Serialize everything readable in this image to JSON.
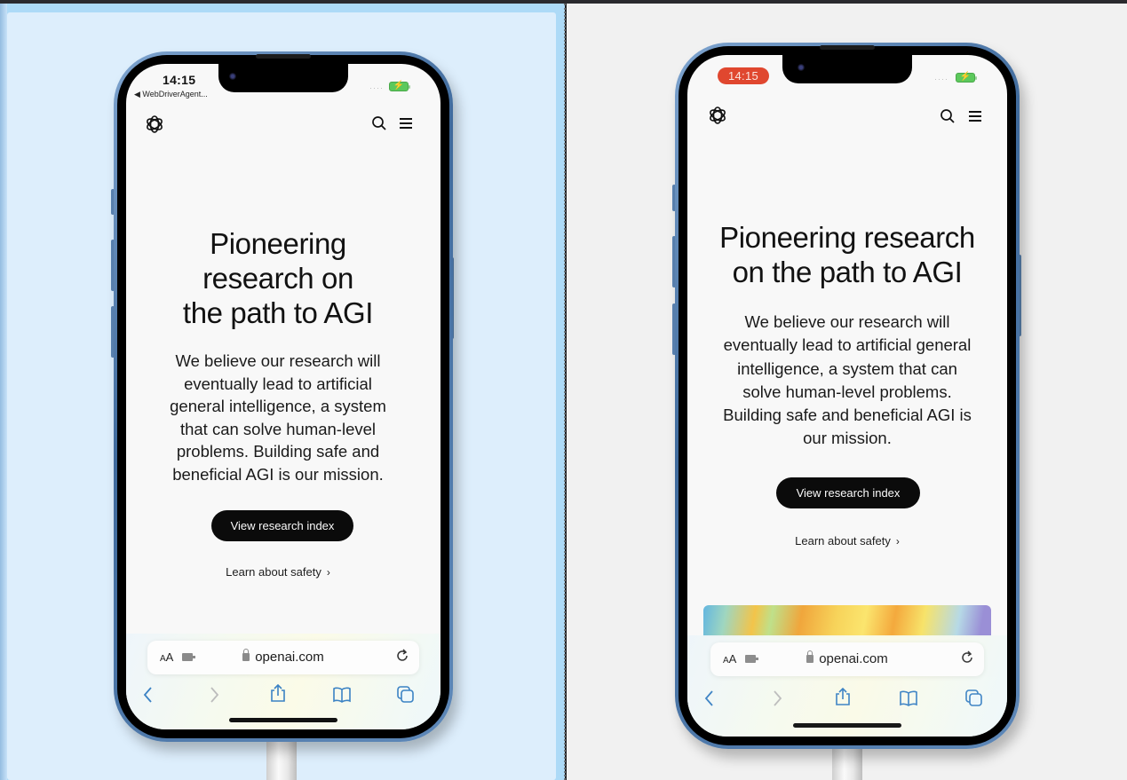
{
  "devices": {
    "left": {
      "status": {
        "time": "14:15",
        "back_app": "◀ WebDriverAgent...",
        "signal": "····",
        "battery": "charging"
      },
      "nav": {
        "logo": "openai-logo",
        "search": "search-icon",
        "menu": "hamburger-menu-icon"
      },
      "hero": {
        "title_lines": [
          "Pioneering",
          "research on",
          "the path to AGI"
        ],
        "body_lines": [
          "We believe our research will",
          "eventually lead to artificial",
          "general intelligence, a system",
          "that can solve human-level",
          "problems. Building safe and",
          "beneficial AGI is our mission."
        ]
      },
      "cta_primary": "View research index",
      "cta_secondary": "Learn about safety",
      "safari": {
        "text_size": "AA",
        "url": "openai.com"
      }
    },
    "right": {
      "status": {
        "time": "14:15",
        "signal": "····",
        "battery": "charging"
      },
      "nav": {
        "logo": "openai-logo",
        "search": "search-icon",
        "menu": "hamburger-menu-icon"
      },
      "hero": {
        "title_lines": [
          "Pioneering research",
          "on the path to AGI"
        ],
        "body_lines": [
          "We believe our research will",
          "eventually lead to artificial general",
          "intelligence, a system that can",
          "solve human-level problems.",
          "Building safe and beneficial AGI is",
          "our mission."
        ]
      },
      "cta_primary": "View research index",
      "cta_secondary": "Learn about safety",
      "safari": {
        "text_size": "AA",
        "url": "openai.com"
      }
    }
  },
  "colors": {
    "left_pane_bg": "#ddeefc",
    "right_pane_bg": "#f1f1f1",
    "recording_pill": "#e0472f",
    "safari_blue": "#3b82c4",
    "cta_bg": "#0b0b0b"
  }
}
